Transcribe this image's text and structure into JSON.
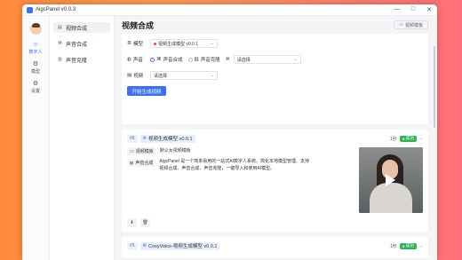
{
  "window": {
    "title": "AigcPanel v0.0.3",
    "controls": [
      "—",
      "□",
      "✕"
    ]
  },
  "leftnav": {
    "items": [
      {
        "label": "数字人",
        "icon": "digital-human-icon",
        "glyph": "☺"
      },
      {
        "label": "模型",
        "icon": "model-icon",
        "glyph": "⚙"
      },
      {
        "label": "设置",
        "icon": "settings-icon",
        "glyph": "⚙"
      }
    ]
  },
  "sidebar": {
    "items": [
      {
        "label": "视频合成",
        "glyph": "▤"
      },
      {
        "label": "声音合成",
        "glyph": "⌘"
      },
      {
        "label": "声音克隆",
        "glyph": "▥"
      }
    ]
  },
  "page": {
    "title": "视频合成",
    "template_button": "视频模板"
  },
  "form": {
    "model_label": "模型",
    "model_value": "视频生成模型 v0.0.1",
    "voice_label": "声音",
    "voice_option_synth": "声音合成",
    "voice_option_clone": "声音克隆",
    "voice_select_placeholder": "请选择",
    "video_label": "视频",
    "video_select_placeholder": "请选择",
    "submit_button": "开始生成视频"
  },
  "tasks": [
    {
      "id": "#6",
      "model": "视频生成模型 v0.0.1",
      "duration": "1秒",
      "status": "成功",
      "template_key": "视频模板",
      "template_value": "默认女视频模板",
      "voice_key": "声音合成",
      "voice_text": "AigcPanel 是一个简单易用的一站式AI数字人系统。简化本地模型管理、支持视频合成、声音合成、声音克隆，一键导入和使用AI模型。"
    },
    {
      "id": "#5",
      "model": "CosyVoice-视频生成模型 v0.0.1",
      "duration": "1秒",
      "status": "成功"
    }
  ]
}
